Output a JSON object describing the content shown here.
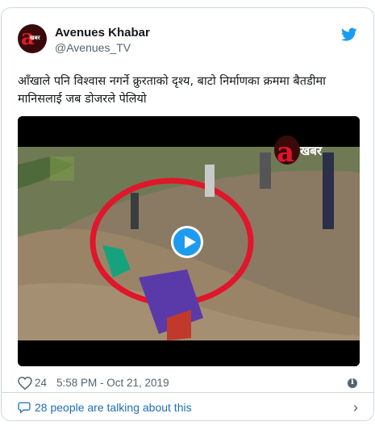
{
  "tweet": {
    "author_name": "Avenues Khabar",
    "author_handle": "@Avenues_TV",
    "avatar_text": "a",
    "avatar_subtext": "खबर",
    "text": "आँखाले पनि विश्वास नगर्ने क्रुरताको दृश्य, बाटो निर्माणका क्रममा बैतडीमा मानिसलाई जब डोजरले पेलियो",
    "likes": "24",
    "timestamp": "5:58 PM - Oct 21, 2019",
    "talking": "28 people are talking about this"
  },
  "video": {
    "watermark_letter": "a",
    "watermark_word": "खबर"
  },
  "colors": {
    "twitter_blue": "#1d9bf0",
    "circle_red": "#e0162b"
  },
  "icons": [
    "twitter-bird-icon",
    "play-icon",
    "heart-icon",
    "info-icon",
    "speech-bubble-icon",
    "chevron-right-icon"
  ]
}
